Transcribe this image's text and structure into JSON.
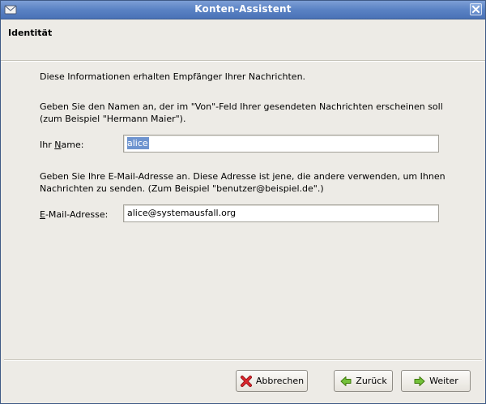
{
  "window": {
    "title": "Konten-Assistent",
    "title_icon": "mail-icon",
    "close_icon": "close-icon"
  },
  "header": {
    "page_title": "Identität"
  },
  "content": {
    "intro": "Diese Informationen erhalten Empfänger Ihrer Nachrichten.",
    "name_instruction": "Geben Sie den Namen an, der im \"Von\"-Feld Ihrer gesendeten Nachrichten erscheinen soll (zum Beispiel \"Hermann Maier\").",
    "name_label_pre": "Ihr ",
    "name_label_mnemonic": "N",
    "name_label_post": "ame:",
    "name_value": "alice",
    "email_instruction": "Geben Sie Ihre E-Mail-Adresse an. Diese Adresse ist jene, die andere verwenden, um Ihnen Nachrichten zu senden. (Zum Beispiel \"benutzer@beispiel.de\".)",
    "email_label_mnemonic": "E",
    "email_label_post": "-Mail-Adresse:",
    "email_value": "alice@systemausfall.org"
  },
  "buttons": {
    "cancel": {
      "label": "Abbrechen",
      "icon": "cancel-x-icon"
    },
    "back": {
      "label": "Zurück",
      "icon": "arrow-left-icon"
    },
    "next": {
      "label": "Weiter",
      "icon": "arrow-right-icon"
    }
  },
  "colors": {
    "titlebar": "#5a82c4",
    "window_bg": "#edebe6",
    "selection": "#6e94cf",
    "arrow_green": "#4e9a06",
    "cancel_red": "#c4161c"
  }
}
